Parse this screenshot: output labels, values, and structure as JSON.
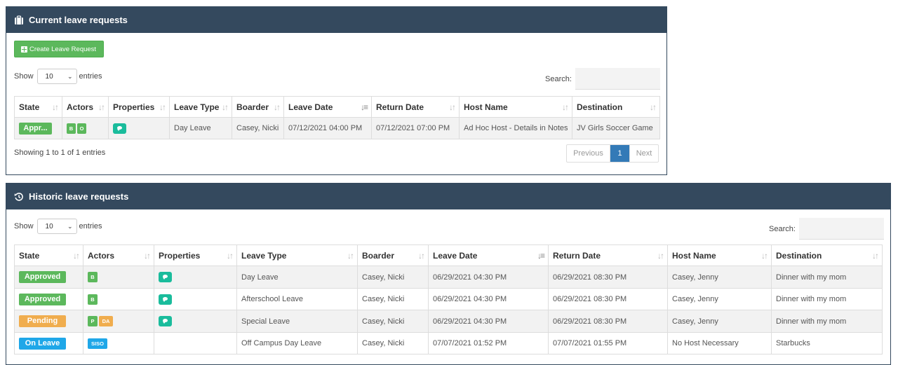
{
  "current": {
    "title": "Current leave requests",
    "create_button": "Create Leave Request",
    "show_label": "Show",
    "entries_value": "10",
    "entries_label": "entries",
    "search_label": "Search:",
    "columns": [
      "State",
      "Actors",
      "Properties",
      "Leave Type",
      "Boarder",
      "Leave Date",
      "Return Date",
      "Host Name",
      "Destination"
    ],
    "rows": [
      {
        "state": "Appr...",
        "actors": [
          "B",
          "O"
        ],
        "leave_type": "Day Leave",
        "boarder": "Casey, Nicki",
        "leave_date": "07/12/2021 04:00 PM",
        "return_date": "07/12/2021 07:00 PM",
        "host": "Ad Hoc Host - Details in Notes",
        "destination": "JV Girls Soccer Game"
      }
    ],
    "info": "Showing 1 to 1 of 1 entries",
    "pager": {
      "prev": "Previous",
      "page": "1",
      "next": "Next"
    }
  },
  "historic": {
    "title": "Historic leave requests",
    "show_label": "Show",
    "entries_value": "10",
    "entries_label": "entries",
    "search_label": "Search:",
    "columns": [
      "State",
      "Actors",
      "Properties",
      "Leave Type",
      "Boarder",
      "Leave Date",
      "Return Date",
      "Host Name",
      "Destination"
    ],
    "rows": [
      {
        "state": "Approved",
        "actors": [
          "B"
        ],
        "leave_type": "Day Leave",
        "boarder": "Casey, Nicki",
        "leave_date": "06/29/2021 04:30 PM",
        "return_date": "06/29/2021 08:30 PM",
        "host": "Casey, Jenny",
        "destination": "Dinner with my mom"
      },
      {
        "state": "Approved",
        "actors": [
          "B"
        ],
        "leave_type": "Afterschool Leave",
        "boarder": "Casey, Nicki",
        "leave_date": "06/29/2021 04:30 PM",
        "return_date": "06/29/2021 08:30 PM",
        "host": "Casey, Jenny",
        "destination": "Dinner with my mom"
      },
      {
        "state": "Pending",
        "actors": [
          "P",
          "DA"
        ],
        "leave_type": "Special Leave",
        "boarder": "Casey, Nicki",
        "leave_date": "06/29/2021 04:30 PM",
        "return_date": "06/29/2021 08:30 PM",
        "host": "Casey, Jenny",
        "destination": "Dinner with my mom"
      },
      {
        "state": "On Leave",
        "actors": [
          "SISO"
        ],
        "leave_type": "Off Campus Day Leave",
        "boarder": "Casey, Nicki",
        "leave_date": "07/07/2021 01:52 PM",
        "return_date": "07/07/2021 01:55 PM",
        "host": "No Host Necessary",
        "destination": "Starbucks"
      }
    ]
  },
  "colors": {
    "header": "#34495e",
    "approved": "#5cb85c",
    "pending": "#f0ad4e",
    "on_leave": "#1fa7e8",
    "properties": "#1abc9c",
    "page_active": "#337ab7"
  },
  "icons": {
    "current_header": "suitcase-icon",
    "historic_header": "history-icon",
    "properties": "comment-icon",
    "create": "plus-square-icon"
  }
}
